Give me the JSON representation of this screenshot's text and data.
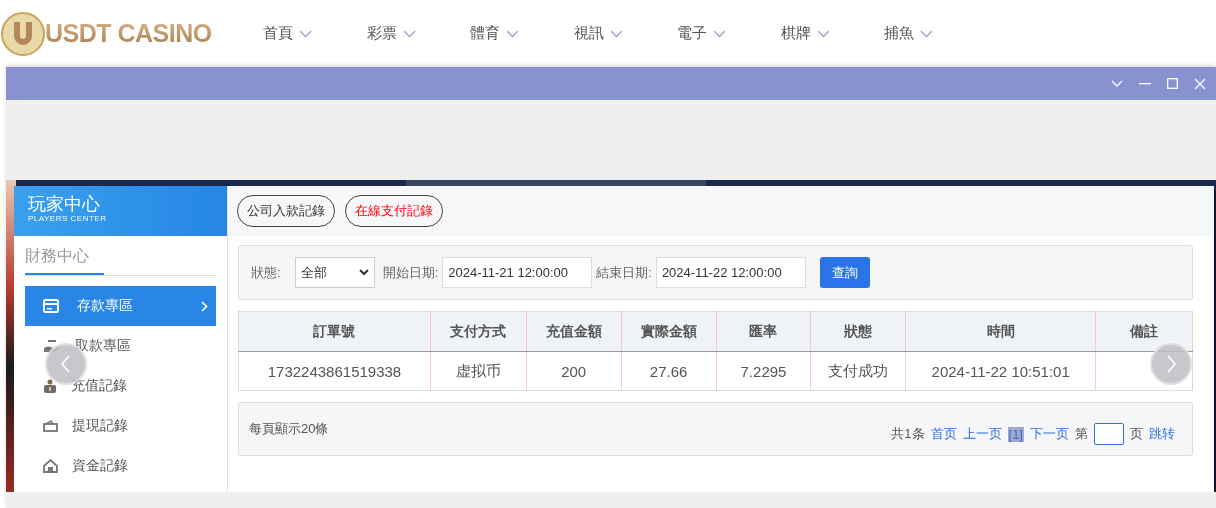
{
  "header": {
    "logo": "USDT CASINO",
    "nav": [
      {
        "label": "首頁"
      },
      {
        "label": "彩票"
      },
      {
        "label": "體育"
      },
      {
        "label": "視訊"
      },
      {
        "label": "電子"
      },
      {
        "label": "棋牌"
      },
      {
        "label": "捕魚"
      }
    ]
  },
  "sidebar": {
    "title": "玩家中心",
    "subtitle": "PLAYERS CENTER",
    "section": "財務中心",
    "items": [
      {
        "label": "存款專區",
        "selected": true,
        "kind": "card"
      },
      {
        "label": "取款專區",
        "selected": false,
        "kind": "hand"
      },
      {
        "label": "充值記錄",
        "selected": false,
        "kind": "bag"
      },
      {
        "label": "提現記錄",
        "selected": false,
        "kind": "wallet"
      },
      {
        "label": "資金記錄",
        "selected": false,
        "kind": "house"
      }
    ]
  },
  "record_tabs": [
    {
      "label": "公司入款記錄",
      "selected": false
    },
    {
      "label": "在線支付記錄",
      "selected": true
    }
  ],
  "filter": {
    "status_label": "狀態:",
    "status_value": "全部",
    "start_label": "開始日期:",
    "start_value": "2024-11-21 12:00:00",
    "end_label": "結束日期:",
    "end_value": "2024-11-22 12:00:00",
    "query_button": "查詢"
  },
  "table": {
    "columns": [
      "訂單號",
      "支付方式",
      "充值金額",
      "實際金額",
      "匯率",
      "狀態",
      "時間",
      "備註"
    ],
    "rows": [
      [
        "1732243861519338",
        "虚拟币",
        "200",
        "27.66",
        "7.2295",
        "支付成功",
        "2024-11-22 10:51:01",
        null
      ]
    ]
  },
  "pagination": {
    "page_size_text": "每頁顯示20條",
    "total": "共1条",
    "first": "首页",
    "prev": "上一页",
    "pages": [
      {
        "label": "[1]",
        "selected": true
      }
    ],
    "next": "下一页",
    "goto_prefix": "第",
    "goto_suffix": "页",
    "jump": "跳转"
  }
}
